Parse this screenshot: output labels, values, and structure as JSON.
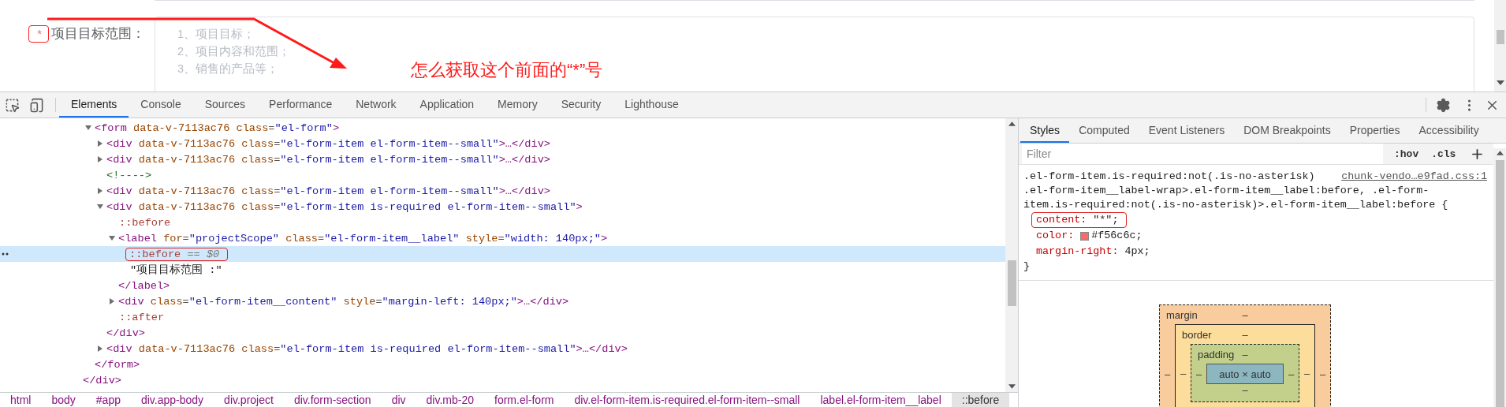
{
  "page": {
    "form_field": {
      "required_mark": "*",
      "mark_highlighted": true,
      "label": "项目目标范围：",
      "placeholder": "1、项目目标；\n2、项目内容和范围；\n3、销售的产品等；"
    },
    "annotation": {
      "arrow": true,
      "callout": "怎么获取这个前面的“*”号"
    }
  },
  "devtools": {
    "tabs": [
      {
        "label": "Elements",
        "selected": true
      },
      {
        "label": "Console",
        "selected": false
      },
      {
        "label": "Sources",
        "selected": false
      },
      {
        "label": "Performance",
        "selected": false
      },
      {
        "label": "Network",
        "selected": false
      },
      {
        "label": "Application",
        "selected": false
      },
      {
        "label": "Memory",
        "selected": false
      },
      {
        "label": "Security",
        "selected": false
      },
      {
        "label": "Lighthouse",
        "selected": false
      }
    ],
    "dom_tree": [
      {
        "kind": "element",
        "expanded": true,
        "selected": false,
        "close": "</div>",
        "children": [
          {
            "kind": "element",
            "open": "<form data-v-7113ac76 class=\"el-form\">",
            "expanded": true,
            "selected": false,
            "close": "</form>",
            "children": [
              {
                "kind": "element",
                "open": "<div data-v-7113ac76 class=\"el-form-item el-form-item--small\">…</div>",
                "expanded": false,
                "selected": false
              },
              {
                "kind": "element",
                "open": "<div data-v-7113ac76 class=\"el-form-item el-form-item--small\">…</div>",
                "expanded": false,
                "selected": false
              },
              {
                "kind": "comment",
                "text": "<!---->",
                "selected": false
              },
              {
                "kind": "element",
                "open": "<div data-v-7113ac76 class=\"el-form-item el-form-item--small\">…</div>",
                "expanded": false,
                "selected": false
              },
              {
                "kind": "element",
                "open": "<div data-v-7113ac76 class=\"el-form-item is-required el-form-item--small\">",
                "expanded": true,
                "selected": false,
                "close": "</div>",
                "children": [
                  {
                    "kind": "pseudo",
                    "text": "::before",
                    "selected": false
                  },
                  {
                    "kind": "element",
                    "open": "<label for=\"projectScope\" class=\"el-form-item__label\" style=\"width: 140px;\">",
                    "expanded": true,
                    "selected": false,
                    "close": "</label>",
                    "children": [
                      {
                        "kind": "pseudo",
                        "text": "::before",
                        "suffix": "== $0",
                        "selected": true,
                        "highlighted": true
                      },
                      {
                        "kind": "text",
                        "text": "\"项目目标范围 :\"",
                        "selected": false
                      }
                    ]
                  },
                  {
                    "kind": "element",
                    "open": "<div class=\"el-form-item__content\" style=\"margin-left: 140px;\">…</div>",
                    "expanded": false,
                    "selected": false
                  },
                  {
                    "kind": "pseudo",
                    "text": "::after",
                    "selected": false
                  }
                ]
              },
              {
                "kind": "element",
                "open": "<div data-v-7113ac76 class=\"el-form-item is-required el-form-item--small\">…</div>",
                "expanded": false,
                "selected": false
              }
            ]
          }
        ]
      }
    ],
    "breadcrumbs": [
      {
        "label": "html",
        "selected": false
      },
      {
        "label": "body",
        "selected": false
      },
      {
        "label": "#app",
        "selected": false
      },
      {
        "label": "div.app-body",
        "selected": false
      },
      {
        "label": "div.project",
        "selected": false
      },
      {
        "label": "div.form-section",
        "selected": false
      },
      {
        "label": "div",
        "selected": false
      },
      {
        "label": "div.mb-20",
        "selected": false
      },
      {
        "label": "form.el-form",
        "selected": false
      },
      {
        "label": "div.el-form-item.is-required.el-form-item--small",
        "selected": false
      },
      {
        "label": "label.el-form-item__label",
        "selected": false
      },
      {
        "label": "::before",
        "selected": true
      }
    ],
    "side_tabs": [
      {
        "label": "Styles",
        "selected": true
      },
      {
        "label": "Computed",
        "selected": false
      },
      {
        "label": "Event Listeners",
        "selected": false
      },
      {
        "label": "DOM Breakpoints",
        "selected": false
      },
      {
        "label": "Properties",
        "selected": false
      },
      {
        "label": "Accessibility",
        "selected": false
      }
    ],
    "filter": {
      "placeholder": "Filter"
    },
    "style_toggles": [
      ":hov",
      ".cls"
    ],
    "rule": {
      "source": "chunk-vendo…e9fad.css:1",
      "selector_lines": [
        ".el-form-item.is-required:not(.is-no-asterisk)",
        ".el-form-item__label-wrap>.el-form-item__label:before, .el-form-",
        "item.is-required:not(.is-no-asterisk)>.el-form-item__label:before {"
      ],
      "declarations": [
        {
          "property": "content:",
          "value": "\"*\";",
          "swatch": false,
          "highlighted": true
        },
        {
          "property": "color:",
          "value": "#f56c6c;",
          "swatch": true,
          "highlighted": false
        },
        {
          "property": "margin-right:",
          "value": "4px;",
          "swatch": false,
          "highlighted": false
        }
      ],
      "close": "}"
    },
    "box_model": {
      "margin": {
        "label": "margin",
        "top": "–",
        "left": "–",
        "right": "–"
      },
      "border": {
        "label": "border",
        "top": "–",
        "left": "–",
        "right": "–"
      },
      "padding": {
        "label": "padding",
        "top": "–",
        "left": "–",
        "right": "–",
        "bottom": "–"
      },
      "content": "auto × auto"
    }
  }
}
